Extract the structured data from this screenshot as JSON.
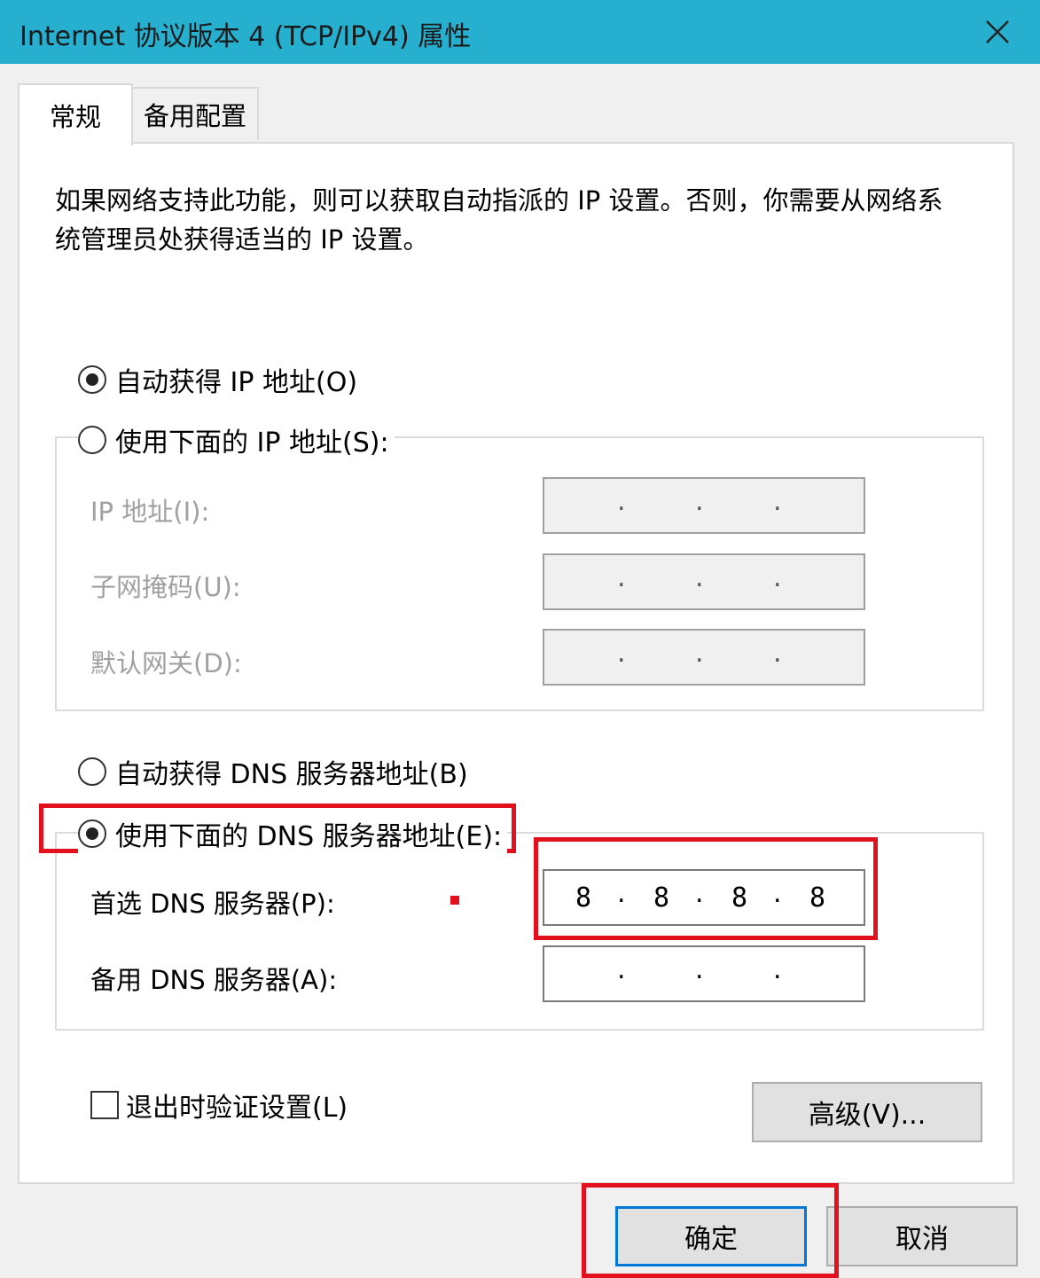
{
  "window": {
    "title": "Internet 协议版本 4 (TCP/IPv4) 属性",
    "close_icon": "close-icon"
  },
  "tabs": [
    {
      "label": "常规",
      "active": true
    },
    {
      "label": "备用配置",
      "active": false
    }
  ],
  "general": {
    "description": "如果网络支持此功能，则可以获取自动指派的 IP 设置。否则，你需要从网络系统管理员处获得适当的 IP 设置。",
    "ip_mode": {
      "auto_label": "自动获得 IP 地址(O)",
      "manual_label": "使用下面的 IP 地址(S):",
      "selected": "auto"
    },
    "ip_fields": [
      {
        "label": "IP 地址(I):",
        "octets": [
          "",
          "",
          "",
          ""
        ]
      },
      {
        "label": "子网掩码(U):",
        "octets": [
          "",
          "",
          "",
          ""
        ]
      },
      {
        "label": "默认网关(D):",
        "octets": [
          "",
          "",
          "",
          ""
        ]
      }
    ],
    "dns_mode": {
      "auto_label": "自动获得 DNS 服务器地址(B)",
      "manual_label": "使用下面的 DNS 服务器地址(E):",
      "selected": "manual"
    },
    "dns_fields": [
      {
        "label": "首选 DNS 服务器(P):",
        "octets": [
          "8",
          "8",
          "8",
          "8"
        ]
      },
      {
        "label": "备用 DNS 服务器(A):",
        "octets": [
          "",
          "",
          "",
          ""
        ]
      }
    ],
    "validate_on_exit": {
      "label": "退出时验证设置(L)",
      "checked": false
    },
    "advanced_button": "高级(V)..."
  },
  "footer": {
    "ok_button": "确定",
    "cancel_button": "取消"
  },
  "colors": {
    "titlebar": "#27afd0",
    "highlight": "#e3101e",
    "default_button_border": "#0078d7"
  }
}
